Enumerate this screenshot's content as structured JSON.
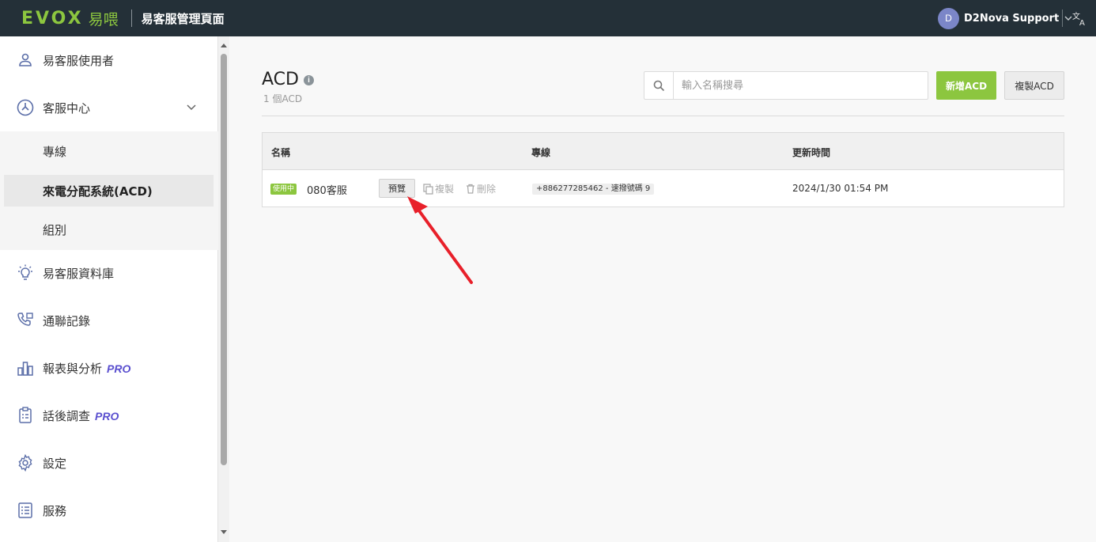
{
  "topbar": {
    "logo_text": "EVOX",
    "logo_cn": "易喂",
    "app_title": "易客服管理頁面",
    "user_initial": "D",
    "user_name": "D2Nova Support"
  },
  "sidebar": {
    "items": [
      {
        "label": "易客服使用者",
        "icon": "user-icon"
      },
      {
        "label": "客服中心",
        "icon": "contact-center-icon"
      },
      {
        "label": "易客服資料庫",
        "icon": "lightbulb-icon"
      },
      {
        "label": "通聯記錄",
        "icon": "phone-log-icon"
      },
      {
        "label": "報表與分析",
        "icon": "bar-chart-icon",
        "pro": "PRO"
      },
      {
        "label": "話後調查",
        "icon": "clipboard-icon",
        "pro": "PRO"
      },
      {
        "label": "設定",
        "icon": "gear-icon"
      },
      {
        "label": "服務",
        "icon": "service-list-icon"
      }
    ],
    "sub_items": [
      {
        "label": "專線"
      },
      {
        "label": "來電分配系統(ACD)"
      },
      {
        "label": "組別"
      }
    ]
  },
  "main": {
    "title": "ACD",
    "count": "1 個ACD",
    "search_placeholder": "輸入名稱搜尋",
    "add_button": "新增ACD",
    "copy_button": "複製ACD",
    "table": {
      "headers": [
        "名稱",
        "專線",
        "更新時間"
      ],
      "rows": [
        {
          "status": "使用中",
          "name": "080客服",
          "preview": "預覽",
          "copy": "複製",
          "delete": "刪除",
          "line": "+886277285462 - 速撥號碼 9",
          "updated": "2024/1/30 01:54 PM"
        }
      ]
    }
  },
  "colors": {
    "topbar_bg": "#243038",
    "brand_green": "#8cc63f",
    "pro_purple": "#5a4fcf",
    "avatar": "#7b86c8",
    "arrow_red": "#e8202a"
  }
}
